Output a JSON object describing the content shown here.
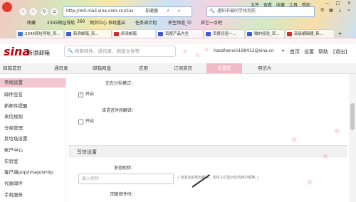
{
  "browser": {
    "menu": [
      "文件",
      "查看",
      "收藏",
      "工具",
      "帮助"
    ],
    "url": "http://m0.mail.sina.com.cn/clas",
    "url_suffix": "加速器",
    "search_placeholder": "通知书被同学找到前",
    "bookmarks": [
      "收藏",
      "2345网址导航",
      "360",
      "网页中心",
      "系统重启",
      "任务调计划",
      "养生频道_中",
      "其它一点吧"
    ],
    "tabs": [
      "2345网址导航_百...",
      "新浪邮箱_百...",
      "新浪邮箱",
      "百度产品大全",
      "百度经验—...",
      "微的经验_百...",
      "高级编辑器_新..."
    ]
  },
  "mail": {
    "logo": "sina",
    "logo_text": "新浪邮箱",
    "search_placeholder": "搜索邮件、通讯录、网盘文件等",
    "user": "haozhenxin199412@sina.cn",
    "dropdown": "▾",
    "links": [
      "首页",
      "设置",
      "帮助",
      "[退出]"
    ]
  },
  "navtabs": [
    "邮箱首页",
    "通讯录",
    "邮箱网盘",
    "应用",
    "订阅资讯",
    "设置区",
    "明信片"
  ],
  "sidebar": [
    "常规设置",
    "邮件签名",
    "新邮件提醒",
    "来信规则",
    "分类管理",
    "反垃圾设置",
    "帐户中心",
    "实验室",
    "客户端pop/imap/smtp",
    "代收邮件",
    "手机服务"
  ],
  "settings": {
    "split_label": "左右分栏模式：",
    "split_option": "开启",
    "translate_label": "该语言时间翻译：",
    "translate_option": "开启",
    "compose_section": "写信设置",
    "nickname_label": "发信昵称：",
    "nickname_placeholder": "输入昵称",
    "nickname_hint": "( 该发出的所有邮件，发件人栏显示您的账户昵称。)",
    "reply_label": "回复邮件时："
  }
}
